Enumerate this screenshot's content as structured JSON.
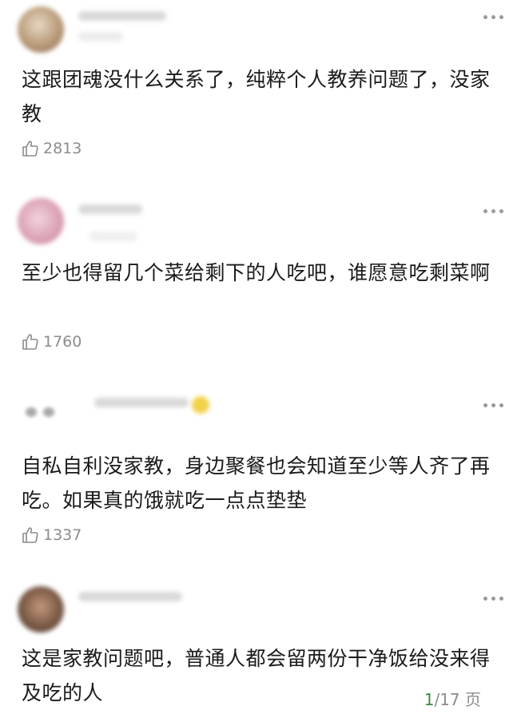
{
  "comments": [
    {
      "avatar_icon": "avatar-blurred",
      "text": "这跟团魂没什么关系了，纯粹个人教养问题了，没家教",
      "likes": "2813",
      "like_icon": "thumbs-up-icon",
      "more_icon": "more-dots-icon"
    },
    {
      "avatar_icon": "avatar-blurred",
      "text": "至少也得留几个菜给剩下的人吃吧，谁愿意吃剩菜啊",
      "likes": "1760",
      "like_icon": "thumbs-up-icon",
      "more_icon": "more-dots-icon"
    },
    {
      "avatar_icon": "avatar-blurred",
      "text": "自私自利没家教，身边聚餐也会知道至少等人齐了再吃。如果真的饿就吃一点点垫垫",
      "likes": "1337",
      "like_icon": "thumbs-up-icon",
      "more_icon": "more-dots-icon"
    },
    {
      "avatar_icon": "avatar-blurred",
      "text": "这是家教问题吧，普通人都会留两份干净饭给没来得及吃的人",
      "more_icon": "more-dots-icon"
    }
  ],
  "pager": {
    "current": "1",
    "total": "/17 页"
  },
  "colors": {
    "text": "#1a1a1a",
    "muted": "#8c8c8c",
    "pager_current": "#3a8a3a"
  }
}
